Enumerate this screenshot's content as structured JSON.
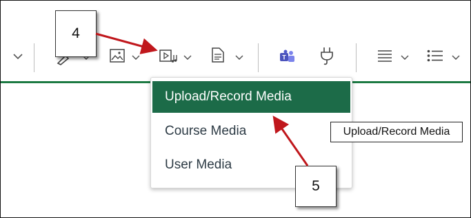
{
  "media_menu": {
    "items": [
      {
        "label": "Upload/Record Media",
        "active": true
      },
      {
        "label": "Course Media",
        "active": false
      },
      {
        "label": "User Media",
        "active": false
      }
    ]
  },
  "tooltip": {
    "text": "Upload/Record Media"
  },
  "callouts": {
    "step4": "4",
    "step5": "5"
  },
  "colors": {
    "accent_green": "#1c6b48",
    "arrow_red": "#c0171c"
  },
  "toolbar": {
    "icons": [
      "link-icon",
      "image-icon",
      "media-icon",
      "document-icon",
      "teams-icon",
      "plug-icon",
      "align-icon",
      "list-icon"
    ]
  }
}
